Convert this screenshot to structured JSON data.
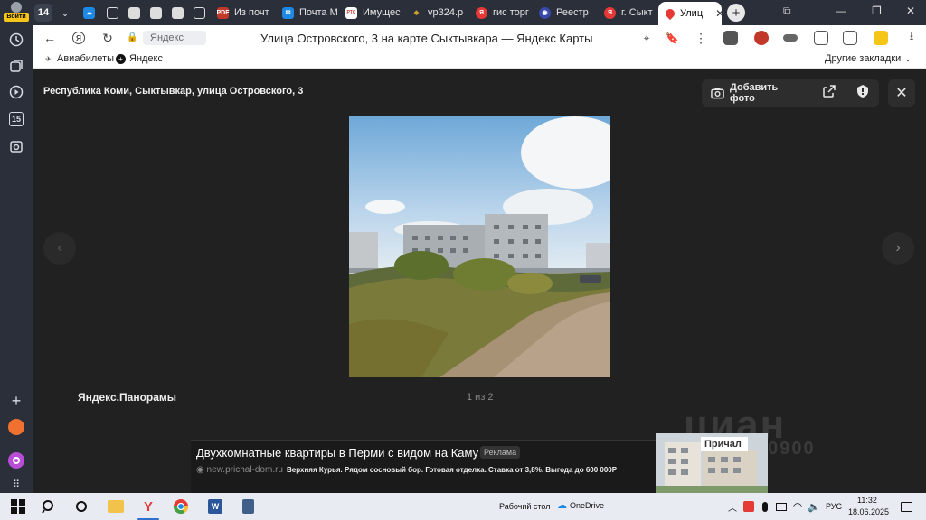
{
  "sidebar": {
    "login_label": "Войти",
    "calendar_badge": "15"
  },
  "tabs": {
    "counter": "14",
    "items": [
      {
        "label": "Из почт",
        "color": "#c0392b",
        "fav_text": "PDF"
      },
      {
        "label": "Почта М",
        "color": "#1e88e5",
        "fav_text": "✉"
      },
      {
        "label": "Имущес",
        "color": "#c0392b",
        "fav_text": "РТС"
      },
      {
        "label": "vp324.p",
        "color": "#c9a227",
        "fav_text": "◆"
      },
      {
        "label": "гис торг",
        "color": "#e53935",
        "fav_text": "Я"
      },
      {
        "label": "Реестр",
        "color": "#3949ab",
        "fav_text": "◉"
      },
      {
        "label": "г. Сыкт",
        "color": "#e53935",
        "fav_text": "Я"
      }
    ],
    "active": {
      "label": "Улиц"
    }
  },
  "toolbar": {
    "site_label": "Яндекс",
    "page_title": "Улица Островского, 3 на карте Сыктывкара — Яндекс Карты"
  },
  "bookmarks": {
    "items": [
      {
        "label": "Авиабилеты"
      },
      {
        "label": "Яндекс"
      }
    ],
    "other": "Другие закладки"
  },
  "viewer": {
    "address": "Республика Коми, Сыктывкар, улица Островского, 3",
    "add_photo": "Добавить фото",
    "brand": "Яндекс.Панорамы",
    "counter": "1 из 2",
    "watermark_logo": "циан",
    "watermark_phone": "10900"
  },
  "ad": {
    "title": "Двухкомнатные квартиры в Перми с видом на Каму",
    "label": "Реклама",
    "domain": "new.prichal-dom.ru",
    "text": "Верхняя Курья. Рядом сосновый бор. Готовая отделка. Ставка от 3,8%. Выгода до 600 000Р",
    "image_sign": "Причал"
  },
  "taskbar": {
    "desktop_label": "Рабочий стол",
    "onedrive_label": "OneDrive",
    "lang": "РУС",
    "time": "11:32",
    "date": "18.06.2025"
  }
}
